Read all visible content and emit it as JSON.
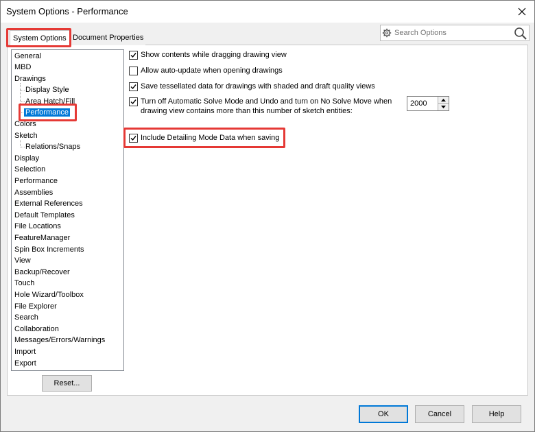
{
  "window": {
    "title": "System Options - Performance"
  },
  "tabs": [
    {
      "label": "System Options",
      "active": true
    },
    {
      "label": "Document Properties",
      "active": false
    }
  ],
  "search": {
    "placeholder": "Search Options"
  },
  "tree": {
    "items": [
      {
        "label": "General",
        "level": 0
      },
      {
        "label": "MBD",
        "level": 0
      },
      {
        "label": "Drawings",
        "level": 0
      },
      {
        "label": "Display Style",
        "level": 1
      },
      {
        "label": "Area Hatch/Fill",
        "level": 1
      },
      {
        "label": "Performance",
        "level": 1,
        "selected": true
      },
      {
        "label": "Colors",
        "level": 0
      },
      {
        "label": "Sketch",
        "level": 0
      },
      {
        "label": "Relations/Snaps",
        "level": 1
      },
      {
        "label": "Display",
        "level": 0
      },
      {
        "label": "Selection",
        "level": 0
      },
      {
        "label": "Performance",
        "level": 0
      },
      {
        "label": "Assemblies",
        "level": 0
      },
      {
        "label": "External References",
        "level": 0
      },
      {
        "label": "Default Templates",
        "level": 0
      },
      {
        "label": "File Locations",
        "level": 0
      },
      {
        "label": "FeatureManager",
        "level": 0
      },
      {
        "label": "Spin Box Increments",
        "level": 0
      },
      {
        "label": "View",
        "level": 0
      },
      {
        "label": "Backup/Recover",
        "level": 0
      },
      {
        "label": "Touch",
        "level": 0
      },
      {
        "label": "Hole Wizard/Toolbox",
        "level": 0
      },
      {
        "label": "File Explorer",
        "level": 0
      },
      {
        "label": "Search",
        "level": 0
      },
      {
        "label": "Collaboration",
        "level": 0
      },
      {
        "label": "Messages/Errors/Warnings",
        "level": 0
      },
      {
        "label": "Import",
        "level": 0
      },
      {
        "label": "Export",
        "level": 0
      }
    ]
  },
  "options": {
    "show_contents": {
      "label": "Show contents while dragging drawing view",
      "checked": true
    },
    "allow_auto_update": {
      "label": "Allow auto-update when opening drawings",
      "checked": false
    },
    "save_tessellated": {
      "label": "Save tessellated data for drawings with shaded and draft quality views",
      "checked": true
    },
    "turn_off_solve": {
      "label_line1": "Turn off Automatic Solve Mode and Undo and turn on No Solve Move when",
      "label_line2": "drawing view contains more than this number of sketch entities:",
      "checked": true,
      "value": "2000"
    },
    "include_detailing": {
      "label": "Include Detailing Mode Data when saving",
      "checked": true
    }
  },
  "buttons": {
    "reset": "Reset...",
    "ok": "OK",
    "cancel": "Cancel",
    "help": "Help"
  },
  "colors": {
    "accent": "#0078d7",
    "highlight": "#e53935"
  }
}
